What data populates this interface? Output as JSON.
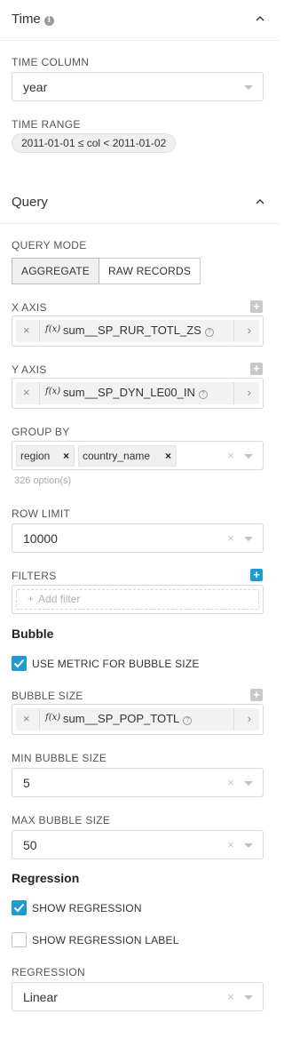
{
  "time_section": {
    "title": "Time",
    "time_column_label": "TIME COLUMN",
    "time_column_value": "year",
    "time_range_label": "TIME RANGE",
    "time_range_value": "2011-01-01 ≤ col < 2011-01-02"
  },
  "query_section": {
    "title": "Query",
    "query_mode_label": "QUERY MODE",
    "modes": [
      "AGGREGATE",
      "RAW RECORDS"
    ],
    "active_mode": "AGGREGATE",
    "x_axis_label": "X AXIS",
    "x_axis_metric": "sum__SP_RUR_TOTL_ZS",
    "y_axis_label": "Y AXIS",
    "y_axis_metric": "sum__SP_DYN_LE00_IN",
    "group_by_label": "GROUP BY",
    "group_by_tags": [
      "region",
      "country_name"
    ],
    "group_by_hint": "326 option(s)",
    "row_limit_label": "ROW LIMIT",
    "row_limit_value": "10000",
    "filters_label": "FILTERS",
    "add_filter_text": "Add filter"
  },
  "bubble_section": {
    "title": "Bubble",
    "use_metric_label": "USE METRIC FOR BUBBLE SIZE",
    "use_metric_checked": true,
    "bubble_size_label": "BUBBLE SIZE",
    "bubble_size_metric": "sum__SP_POP_TOTL",
    "min_bubble_label": "MIN BUBBLE SIZE",
    "min_bubble_value": "5",
    "max_bubble_label": "MAX BUBBLE SIZE",
    "max_bubble_value": "50"
  },
  "regression_section": {
    "title": "Regression",
    "show_regression_label": "SHOW REGRESSION",
    "show_regression_checked": true,
    "show_regression_label_label": "SHOW REGRESSION LABEL",
    "show_regression_label_checked": false,
    "regression_label": "REGRESSION",
    "regression_value": "Linear"
  },
  "symbols": {
    "info": "i",
    "fx": "f(x)",
    "question": "?",
    "clear": "×",
    "remove": "×",
    "plus": "+",
    "chevron_right": "›"
  },
  "colors": {
    "accent": "#1f9bd1",
    "border": "#d9d9d9",
    "label": "#555555"
  }
}
